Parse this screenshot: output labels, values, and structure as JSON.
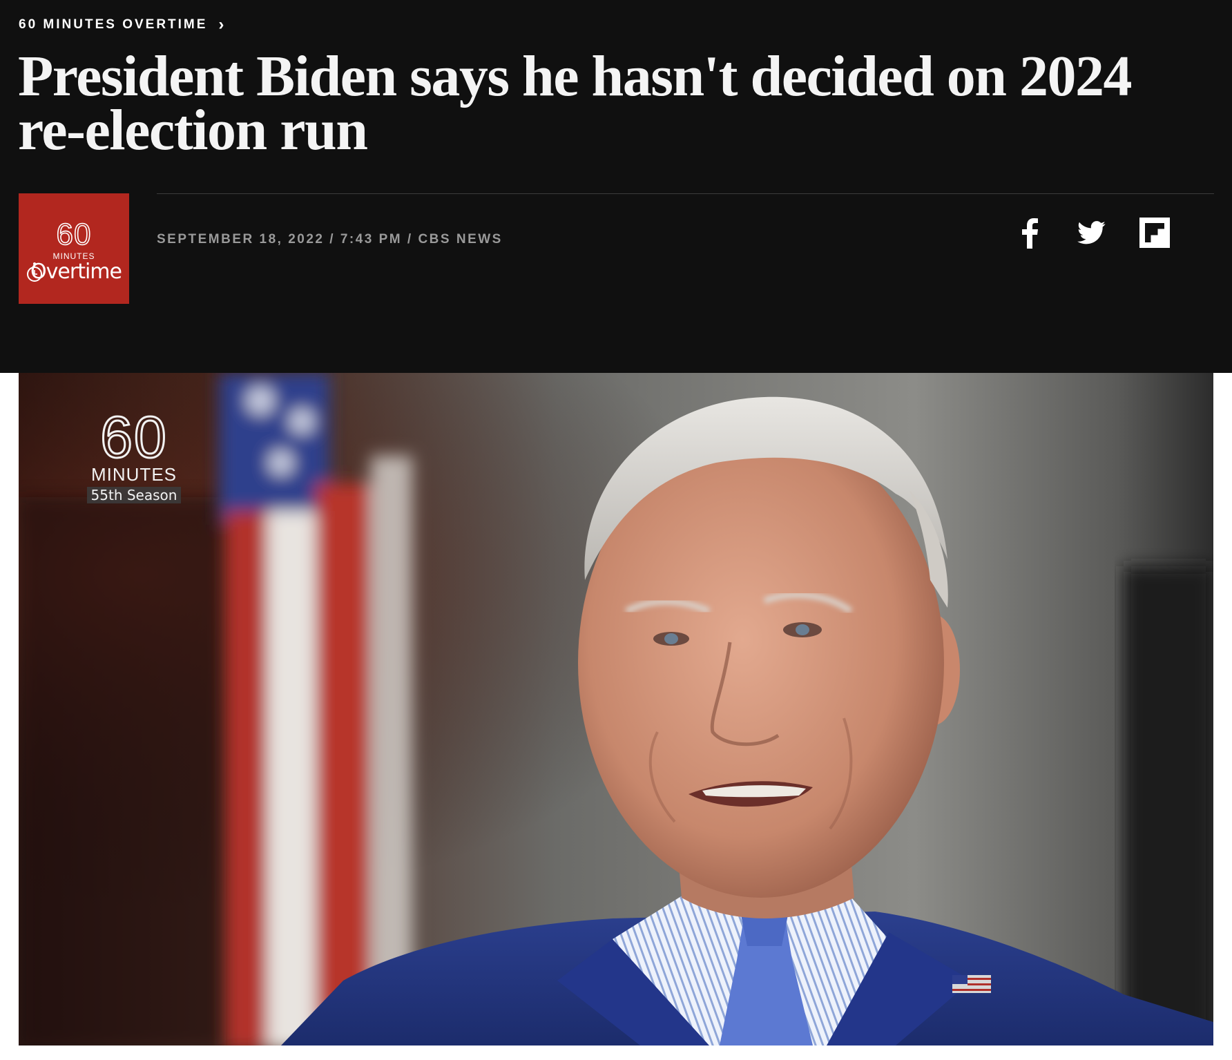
{
  "header": {
    "kicker": "60 MINUTES OVERTIME",
    "kicker_chevron": "›",
    "headline": "President Biden says he hasn't decided on 2024 re-election run"
  },
  "show_logo": {
    "number": "60",
    "minutes": "MINUTES",
    "word": "Overtime",
    "bg_color": "#b2271f"
  },
  "byline": {
    "text": "SEPTEMBER 18, 2022 / 7:43 PM / CBS NEWS"
  },
  "share": [
    {
      "network": "facebook",
      "icon": "facebook-icon"
    },
    {
      "network": "twitter",
      "icon": "twitter-icon"
    },
    {
      "network": "flipboard",
      "icon": "flipboard-icon"
    }
  ],
  "hero": {
    "bug_number": "60",
    "bug_minutes": "MINUTES",
    "bug_season": "55th Season"
  },
  "colors": {
    "header_bg": "#101010",
    "headline": "#f4f4f4",
    "byline": "#9a9a9a",
    "logo_red": "#b2271f"
  }
}
